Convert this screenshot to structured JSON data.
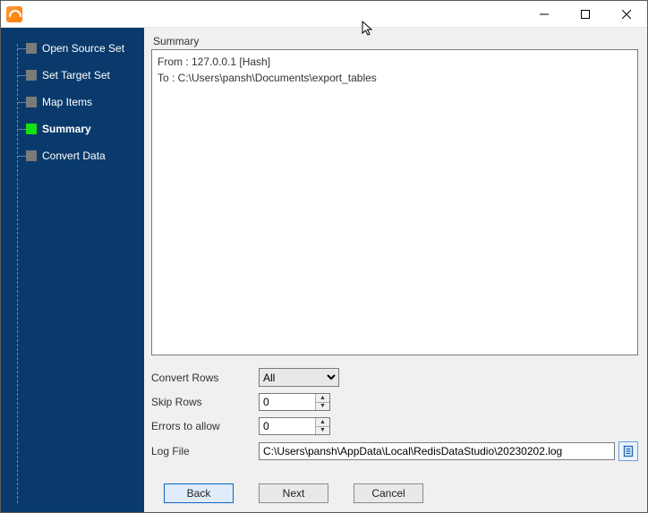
{
  "sidebar": {
    "steps": [
      {
        "label": "Open Source Set",
        "active": false
      },
      {
        "label": "Set Target Set",
        "active": false
      },
      {
        "label": "Map Items",
        "active": false
      },
      {
        "label": "Summary",
        "active": true
      },
      {
        "label": "Convert Data",
        "active": false
      }
    ]
  },
  "main": {
    "section_title": "Summary",
    "summary_text": "From : 127.0.0.1 [Hash]\nTo : C:\\Users\\pansh\\Documents\\export_tables",
    "fields": {
      "convert_rows": {
        "label": "Convert Rows",
        "value": "All",
        "options": [
          "All"
        ]
      },
      "skip_rows": {
        "label": "Skip Rows",
        "value": "0"
      },
      "errors_to_allow": {
        "label": "Errors to allow",
        "value": "0"
      },
      "log_file": {
        "label": "Log File",
        "value": "C:\\Users\\pansh\\AppData\\Local\\RedisDataStudio\\20230202.log"
      }
    },
    "buttons": {
      "back": "Back",
      "next": "Next",
      "cancel": "Cancel"
    }
  }
}
